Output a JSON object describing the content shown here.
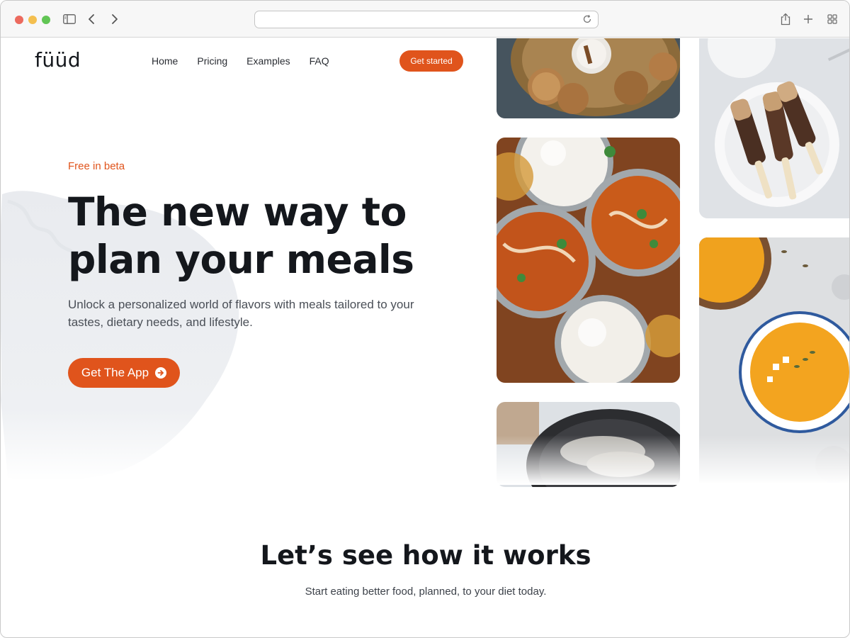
{
  "brand": {
    "accent": "#e0541c",
    "text": "#14171c"
  },
  "browser": {
    "icons": [
      "sidebar-icon",
      "back-icon",
      "forward-icon",
      "reload-icon",
      "share-icon",
      "new-tab-icon",
      "tab-overview-icon"
    ]
  },
  "header": {
    "logo": "füüd",
    "nav": [
      "Home",
      "Pricing",
      "Examples",
      "FAQ"
    ],
    "cta": "Get started"
  },
  "hero": {
    "eyebrow": "Free in beta",
    "headline": "The new way to plan your meals",
    "subcopy": "Unlock a personalized world of flavors with meals tailored to your tastes, dietary needs, and lifestyle.",
    "cta": "Get The App",
    "cta_icon": "arrow-right-circle-icon"
  },
  "gallery": [
    {
      "name": "cookies-tile"
    },
    {
      "name": "popsicles-tile"
    },
    {
      "name": "curry-tile"
    },
    {
      "name": "soup-tile"
    },
    {
      "name": "fish-pan-tile"
    }
  ],
  "how_it_works": {
    "title": "Let’s see how it works",
    "subtitle": "Start eating better food, planned, to your diet today."
  }
}
